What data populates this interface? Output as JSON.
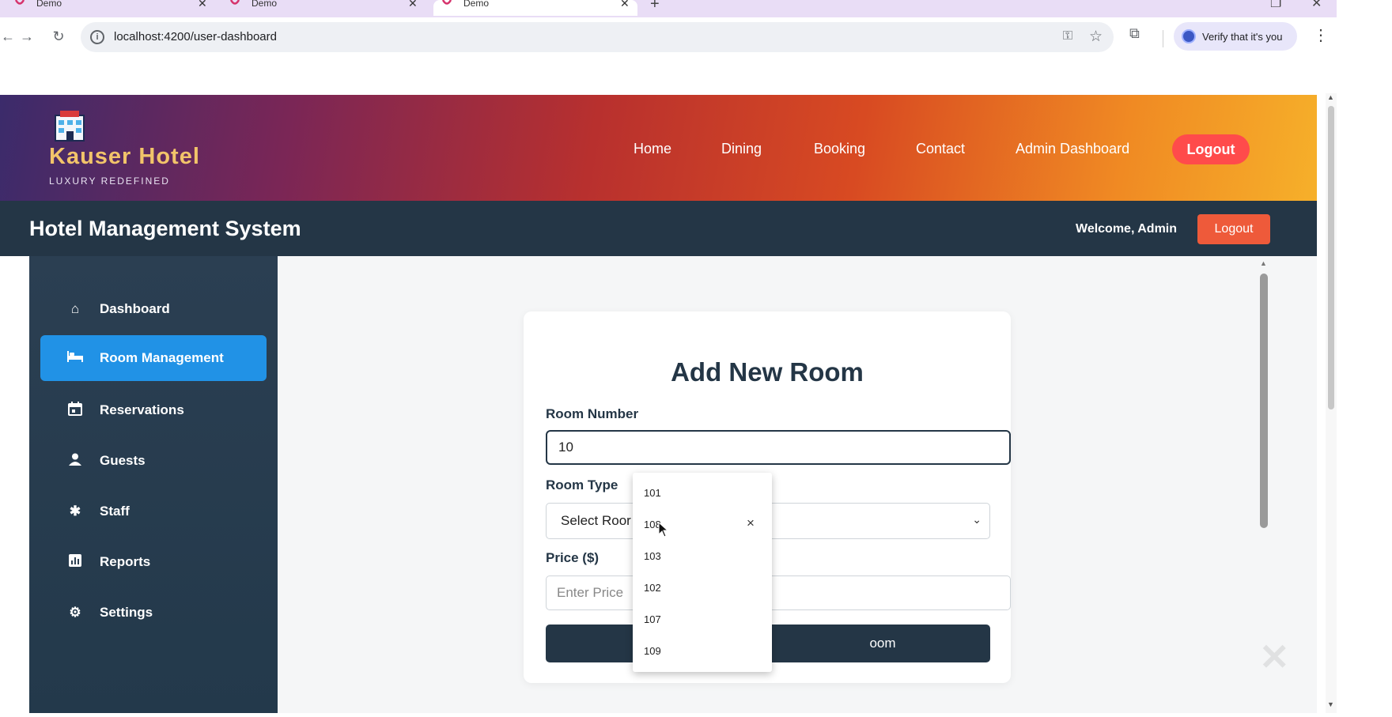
{
  "browser": {
    "tabs": [
      {
        "title": "Demo",
        "active": false
      },
      {
        "title": "Demo",
        "active": false
      },
      {
        "title": "Demo",
        "active": true
      }
    ],
    "new_tab_icon": "+",
    "url": "localhost:4200/user-dashboard",
    "profile_label": "Verify that it's you"
  },
  "hotel": {
    "brand_name": "Kauser Hotel",
    "tagline": "LUXURY REDEFINED",
    "nav": [
      "Home",
      "Dining",
      "Booking",
      "Contact",
      "Admin Dashboard"
    ],
    "logout_label": "Logout"
  },
  "system": {
    "title": "Hotel Management System",
    "welcome": "Welcome, Admin",
    "logout_label": "Logout"
  },
  "sidebar": {
    "items": [
      {
        "label": "Dashboard",
        "icon": "home-icon",
        "active": false
      },
      {
        "label": "Room Management",
        "icon": "bed-icon",
        "active": true
      },
      {
        "label": "Reservations",
        "icon": "calendar-icon",
        "active": false
      },
      {
        "label": "Guests",
        "icon": "person-icon",
        "active": false
      },
      {
        "label": "Staff",
        "icon": "staff-icon",
        "active": false
      },
      {
        "label": "Reports",
        "icon": "chart-icon",
        "active": false
      },
      {
        "label": "Settings",
        "icon": "gear-icon",
        "active": false
      }
    ]
  },
  "form": {
    "title": "Add New Room",
    "room_number_label": "Room Number",
    "room_number_value": "10",
    "room_type_label": "Room Type",
    "room_type_selected": "Select Roor",
    "price_label": "Price ($)",
    "price_placeholder": "Enter Price",
    "submit_label_visible": "oom"
  },
  "autocomplete": {
    "options": [
      "101",
      "108",
      "103",
      "102",
      "107",
      "109"
    ],
    "close_icon": "×"
  },
  "colors": {
    "navy": "#243646",
    "accent_blue": "#2192e6",
    "logout_red": "#ff4b4b",
    "system_logout": "#ee5a3a",
    "brand_gold": "#f2c46a"
  }
}
